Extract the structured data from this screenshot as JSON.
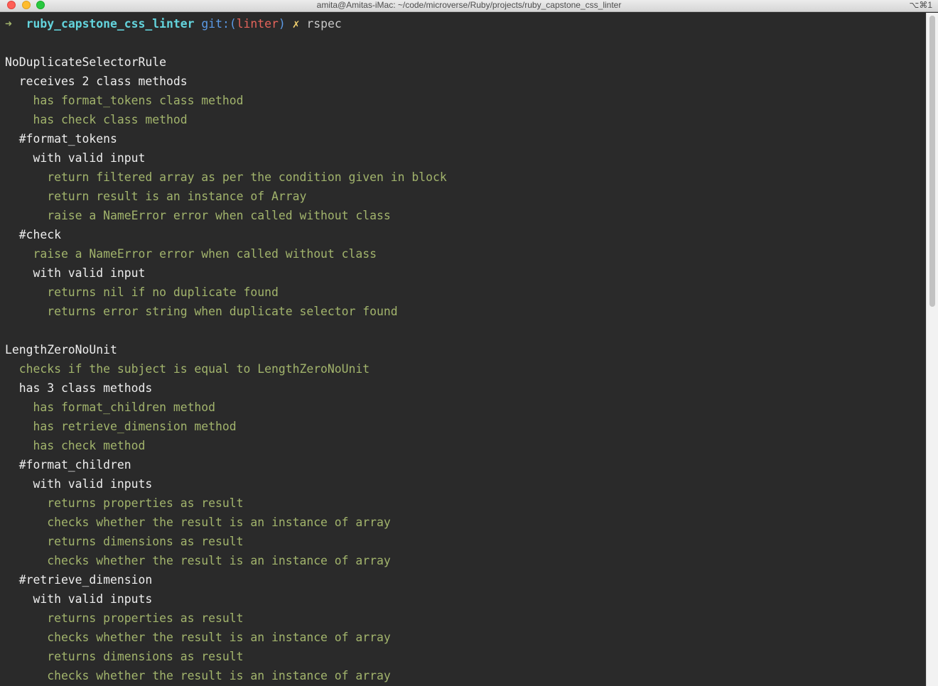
{
  "window": {
    "title": "amita@Amitas-iMac: ~/code/microverse/Ruby/projects/ruby_capstone_css_linter",
    "shortcut": "⌥⌘1"
  },
  "prompt": {
    "arrow": "➜",
    "directory": "ruby_capstone_css_linter",
    "git_label": "git:(",
    "branch": "linter",
    "git_close": ")",
    "dirty_mark": "✗",
    "command": "rspec"
  },
  "output": {
    "lines": [
      "NoDuplicateSelectorRule",
      "  receives 2 class methods",
      "    has format_tokens class method",
      "    has check class method",
      "  #format_tokens",
      "    with valid input",
      "      return filtered array as per the condition given in block",
      "      return result is an instance of Array",
      "      raise a NameError error when called without class",
      "  #check",
      "    raise a NameError error when called without class",
      "    with valid input",
      "      returns nil if no duplicate found",
      "      returns error string when duplicate selector found",
      "LengthZeroNoUnit",
      "  checks if the subject is equal to LengthZeroNoUnit",
      "  has 3 class methods",
      "    has format_children method",
      "    has retrieve_dimension method",
      "    has check method",
      "  #format_children",
      "    with valid inputs",
      "      returns properties as result",
      "      checks whether the result is an instance of array",
      "      returns dimensions as result",
      "      checks whether the result is an instance of array",
      "  #retrieve_dimension",
      "    with valid inputs",
      "      returns properties as result",
      "      checks whether the result is an instance of array",
      "      returns dimensions as result",
      "      checks whether the result is an instance of array"
    ]
  },
  "colors": {
    "background": "#2a2a2a",
    "group_text": "#eeeeee",
    "passing_example": "#a2b46c",
    "prompt_directory": "#63d4dd",
    "prompt_git": "#5b9ae6",
    "prompt_branch": "#e5645b"
  }
}
